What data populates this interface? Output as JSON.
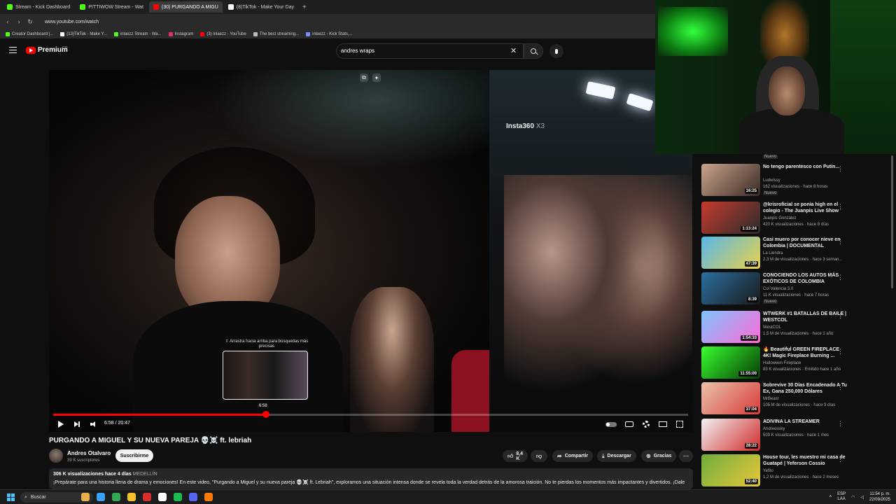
{
  "browser": {
    "tabs": [
      {
        "label": "Stream - Kick Dashboard",
        "color": "#53fc18",
        "active": false
      },
      {
        "label": "PITTIWOW Stream - Wat",
        "color": "#53fc18",
        "active": false
      },
      {
        "label": "(30) PURGANDO A MIGU",
        "color": "#ff0000",
        "active": true
      },
      {
        "label": "(8)TikTok - Make Your Day",
        "color": "#ffffff",
        "active": false
      }
    ],
    "new_tab": "+",
    "url": "www.youtube.com/watch",
    "bookmarks": [
      {
        "label": "Creator Dashboard |...",
        "color": "#53fc18"
      },
      {
        "label": "(13)TikTok - Make Y...",
        "color": "#ffffff"
      },
      {
        "label": "inlaezz Stream - Wa...",
        "color": "#53fc18"
      },
      {
        "label": "Instagram",
        "color": "#e1306c"
      },
      {
        "label": "(3) inlaezz - YouTube",
        "color": "#ff0000"
      },
      {
        "label": "The best streaming...",
        "color": "#bbbbbb"
      },
      {
        "label": "inlaezz - Kick Stats,...",
        "color": "#7b8cff"
      }
    ]
  },
  "youtube": {
    "logo_text": "Premium",
    "logo_sup": "CO",
    "search_value": "andres wraps",
    "clear": "✕"
  },
  "player": {
    "overlay_label": "Insta360",
    "overlay_label_suffix": "X3",
    "scrub_hint": "⇧ Arrastra hacia arriba para búsquedas más precisas",
    "scrub_time": "6:58",
    "time": "6:58 / 20:47",
    "progress": 0.3357
  },
  "video": {
    "title": "PURGANDO A MIGUEL Y SU NUEVA PAREJA 💀☠️ ft. lebriah",
    "channel": "Andres Otalvaro",
    "subscribers": "39 K suscriptores",
    "subscribe": "Suscribirme",
    "likes": "8,4 K",
    "share": "Compartir",
    "download": "Descargar",
    "thanks": "Gracias",
    "desc_meta": "306 K visualizaciones  hace 4 días",
    "desc_location": "MEDELLÍN",
    "desc_text": "¡Prepárate para una historia llena de drama y emociones! En este video, \"Purgando a Miguel y su nueva pareja 💀☠️ ft. Lebriah\", exploramos una situación intensa donde se revela toda la verdad detrás de la amorosa traición. No te pierdas los momentos más impactantes y divertidos. ¡Dale"
  },
  "sidebar": {
    "top_badge": "Nuevo",
    "items": [
      {
        "title": "No tengo parentesco con Putin...",
        "channel": "Ludwissy",
        "meta": "162 visualizaciones · hace 8 horas",
        "duration": "16:25",
        "badge": "Nuevo",
        "c1": "#c9a58f",
        "c2": "#3a2a24"
      },
      {
        "title": "@krisroficial se ponia high en el colegio - The Juanpis Live Show",
        "channel": "Juanpis González",
        "meta": "420 K visualizaciones · hace 8 días",
        "duration": "1:13:24",
        "badge": "",
        "c1": "#c63a2d",
        "c2": "#2b2b2b"
      },
      {
        "title": "Casi muero por conocer nieve en Colombia | DOCUMENTAL",
        "channel": "La Liendra",
        "meta": "2,3 M de visualizaciones · hace 3 seman...",
        "duration": "47:39",
        "badge": "",
        "c1": "#59b7e8",
        "c2": "#e7d24a"
      },
      {
        "title": "CONOCIENDO LOS AUTOS MÁS EXÓTICOS DE COLOMBIA",
        "channel": "Col Valencia 3.0",
        "meta": "11 K visualizaciones · hace 7 horas",
        "duration": "8:39",
        "badge": "Nuevo",
        "c1": "#2a6fa0",
        "c2": "#1a1a1a"
      },
      {
        "title": "WTWERK #1 BATALLAS DE BAILE | WESTCOL",
        "channel": "WestCOL",
        "meta": "1,5 M de visualizaciones · hace 1 año",
        "duration": "1:54:33",
        "badge": "",
        "c1": "#7ec4ff",
        "c2": "#ff6ad5"
      },
      {
        "title": "🔥 Beautiful GREEN FIREPLACE 4K! Magic Fireplace Burning ...",
        "channel": "Halloween Fireplace",
        "meta": "83 K visualizaciones · Emitido hace 1 año",
        "duration": "11:55:00",
        "badge": "",
        "c1": "#39ff2e",
        "c2": "#063d07"
      },
      {
        "title": "Sobrevive 30 Días Encadenado A Tu Ex, Gana 250,000 Dólares",
        "channel": "MrBeast",
        "meta": "105 M de visualizaciones · hace 9 días",
        "duration": "37:04",
        "badge": "",
        "c1": "#e9c3a8",
        "c2": "#d93b3b"
      },
      {
        "title": "ADIVINA LA STREAMER",
        "channel": "Andreossky",
        "meta": "503 K visualizaciones · hace 1 mes",
        "duration": "28:22",
        "badge": "",
        "c1": "#f2f2f2",
        "c2": "#d02a2a"
      },
      {
        "title": "House tour, les muestro mi casa de Guatapé | Yeferson Cossio",
        "channel": "Yefito",
        "meta": "1,2 M de visualizaciones · hace 2 meses",
        "duration": "52:40",
        "badge": "",
        "c1": "#6fae3c",
        "c2": "#e8c63a"
      }
    ]
  },
  "taskbar": {
    "search": "Buscar",
    "lang": "ESP",
    "lang2": "LAA",
    "time": "11:54 p. m.",
    "date": "22/09/2025",
    "apps": [
      "#e8b04a",
      "#3aa0ff",
      "#34a853",
      "#f2c12e",
      "#d62c2c",
      "#ffffff",
      "#1db954",
      "#5865f2",
      "#ff7a00"
    ]
  }
}
